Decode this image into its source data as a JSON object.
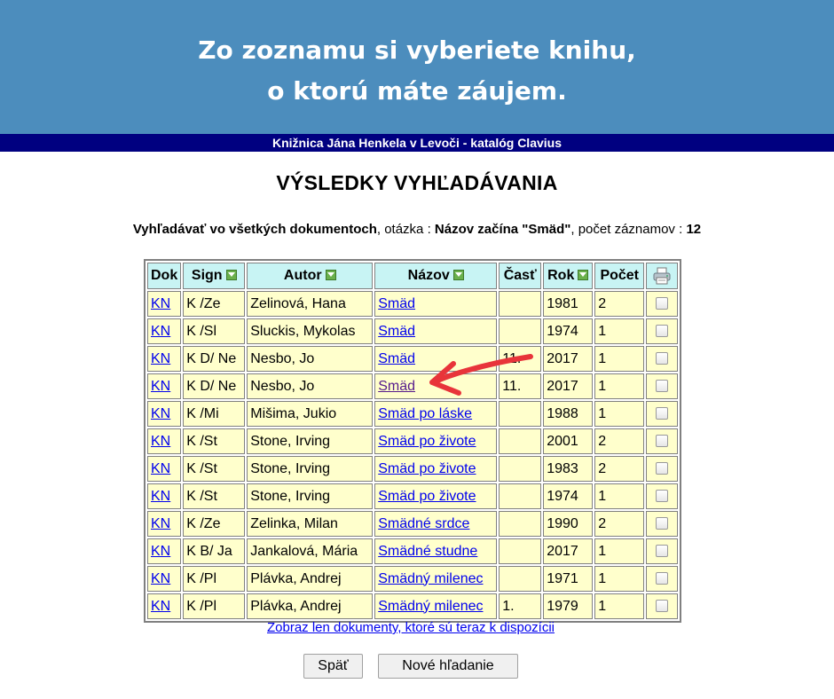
{
  "banner": {
    "line1": "Zo zoznamu si vyberiete knihu,",
    "line2": "o ktorú máte záujem."
  },
  "catalog_bar": "Knižnica Jána Henkela v Levoči - katalóg Clavius",
  "page_title": "VÝSLEDKY VYHĽADÁVANIA",
  "query": {
    "scope": "Vyhľadávať vo všetkých dokumentoch",
    "question_label": ", otázka : ",
    "question": "Názov začína \"Smäd\"",
    "count_label": ", počet záznamov : ",
    "count": "12"
  },
  "table": {
    "headers": {
      "dok": "Dok",
      "sign": "Sign",
      "autor": "Autor",
      "nazov": "Názov",
      "cast": "Časť",
      "rok": "Rok",
      "pocet": "Počet"
    },
    "rows": [
      {
        "dok": "KN",
        "sign": "K /Ze",
        "autor": "Zelinová, Hana",
        "nazov": "Smäd",
        "cast": "",
        "rok": "1981",
        "pocet": "2"
      },
      {
        "dok": "KN",
        "sign": "K /Sl",
        "autor": "Sluckis, Mykolas",
        "nazov": "Smäd",
        "cast": "",
        "rok": "1974",
        "pocet": "1"
      },
      {
        "dok": "KN",
        "sign": "K D/ Ne",
        "autor": "Nesbo, Jo",
        "nazov": "Smäd",
        "cast": "11.",
        "rok": "2017",
        "pocet": "1"
      },
      {
        "dok": "KN",
        "sign": "K D/ Ne",
        "autor": "Nesbo, Jo",
        "nazov": "Smäd",
        "cast": "11.",
        "rok": "2017",
        "pocet": "1"
      },
      {
        "dok": "KN",
        "sign": "K /Mi",
        "autor": "Mišima, Jukio",
        "nazov": "Smäd po láske",
        "cast": "",
        "rok": "1988",
        "pocet": "1"
      },
      {
        "dok": "KN",
        "sign": "K /St",
        "autor": "Stone, Irving",
        "nazov": "Smäd po živote",
        "cast": "",
        "rok": "2001",
        "pocet": "2"
      },
      {
        "dok": "KN",
        "sign": "K /St",
        "autor": "Stone, Irving",
        "nazov": "Smäd po živote",
        "cast": "",
        "rok": "1983",
        "pocet": "2"
      },
      {
        "dok": "KN",
        "sign": "K /St",
        "autor": "Stone, Irving",
        "nazov": "Smäd po živote",
        "cast": "",
        "rok": "1974",
        "pocet": "1"
      },
      {
        "dok": "KN",
        "sign": "K /Ze",
        "autor": "Zelinka, Milan",
        "nazov": "Smädné srdce",
        "cast": "",
        "rok": "1990",
        "pocet": "2"
      },
      {
        "dok": "KN",
        "sign": "K B/ Ja",
        "autor": "Jankalová, Mária",
        "nazov": "Smädné studne",
        "cast": "",
        "rok": "2017",
        "pocet": "1"
      },
      {
        "dok": "KN",
        "sign": "K /Pl",
        "autor": "Plávka, Andrej",
        "nazov": "Smädný milenec",
        "cast": "",
        "rok": "1971",
        "pocet": "1"
      },
      {
        "dok": "KN",
        "sign": "K /Pl",
        "autor": "Plávka, Andrej",
        "nazov": "Smädný milenec",
        "cast": "1.",
        "rok": "1979",
        "pocet": "1"
      }
    ]
  },
  "available_link": "Zobraz len dokumenty, ktoré sú teraz k dispozícii",
  "buttons": {
    "back": "Späť",
    "new_search": "Nové hľadanie"
  },
  "colors": {
    "banner": "#4c8dbd",
    "catalog_bar": "#000080",
    "header_cell": "#c8f4f4",
    "row_cell": "#ffffcc",
    "annotation_arrow": "#e8343a"
  },
  "icons": {
    "sort": "sort-arrow-icon",
    "print": "printer-icon"
  }
}
